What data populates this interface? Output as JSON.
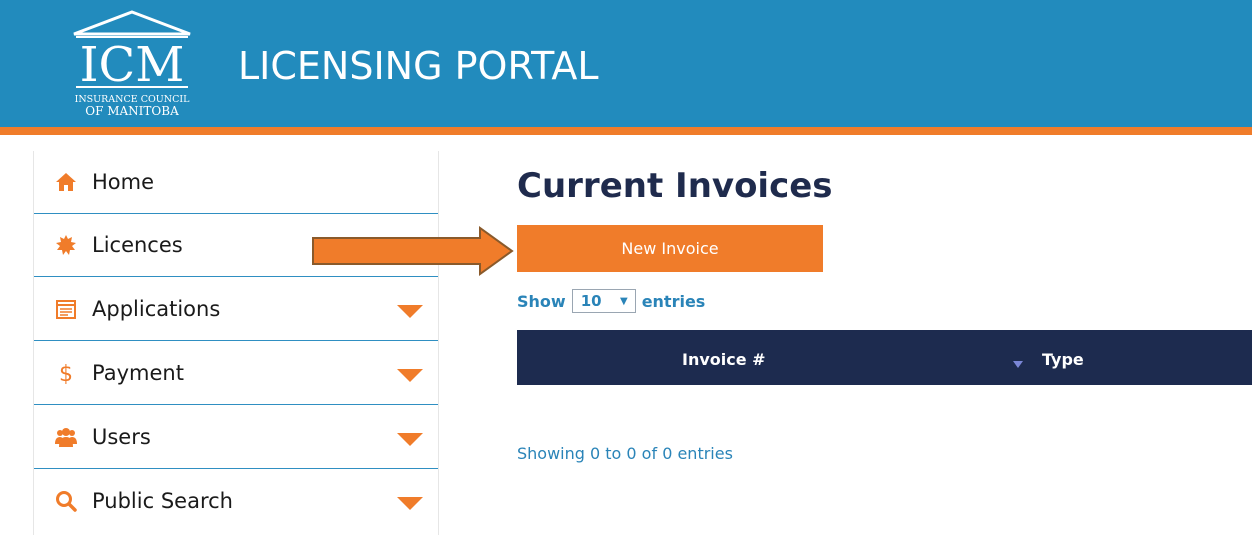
{
  "header": {
    "logo_text": "ICM",
    "logo_subtitle_1": "INSURANCE COUNCIL",
    "logo_subtitle_2": "OF MANITOBA",
    "title": "LICENSING PORTAL"
  },
  "colors": {
    "header_blue": "#228bbd",
    "accent_orange": "#f07c2a",
    "navy": "#1d2b4f",
    "link_blue": "#2a84b8"
  },
  "sidebar": {
    "items": [
      {
        "label": "Home",
        "icon": "home-icon",
        "expandable": false
      },
      {
        "label": "Licences",
        "icon": "badge-icon",
        "expandable": false
      },
      {
        "label": "Applications",
        "icon": "form-icon",
        "expandable": true
      },
      {
        "label": "Payment",
        "icon": "dollar-icon",
        "expandable": true
      },
      {
        "label": "Users",
        "icon": "users-icon",
        "expandable": true
      },
      {
        "label": "Public Search",
        "icon": "search-icon",
        "expandable": true
      }
    ]
  },
  "main": {
    "title": "Current Invoices",
    "new_invoice_label": "New Invoice",
    "show_label": "Show",
    "entries_label": "entries",
    "page_size": "10",
    "columns": [
      "Invoice #",
      "Type"
    ],
    "rows": [],
    "info": "Showing 0 to 0 of 0 entries"
  }
}
